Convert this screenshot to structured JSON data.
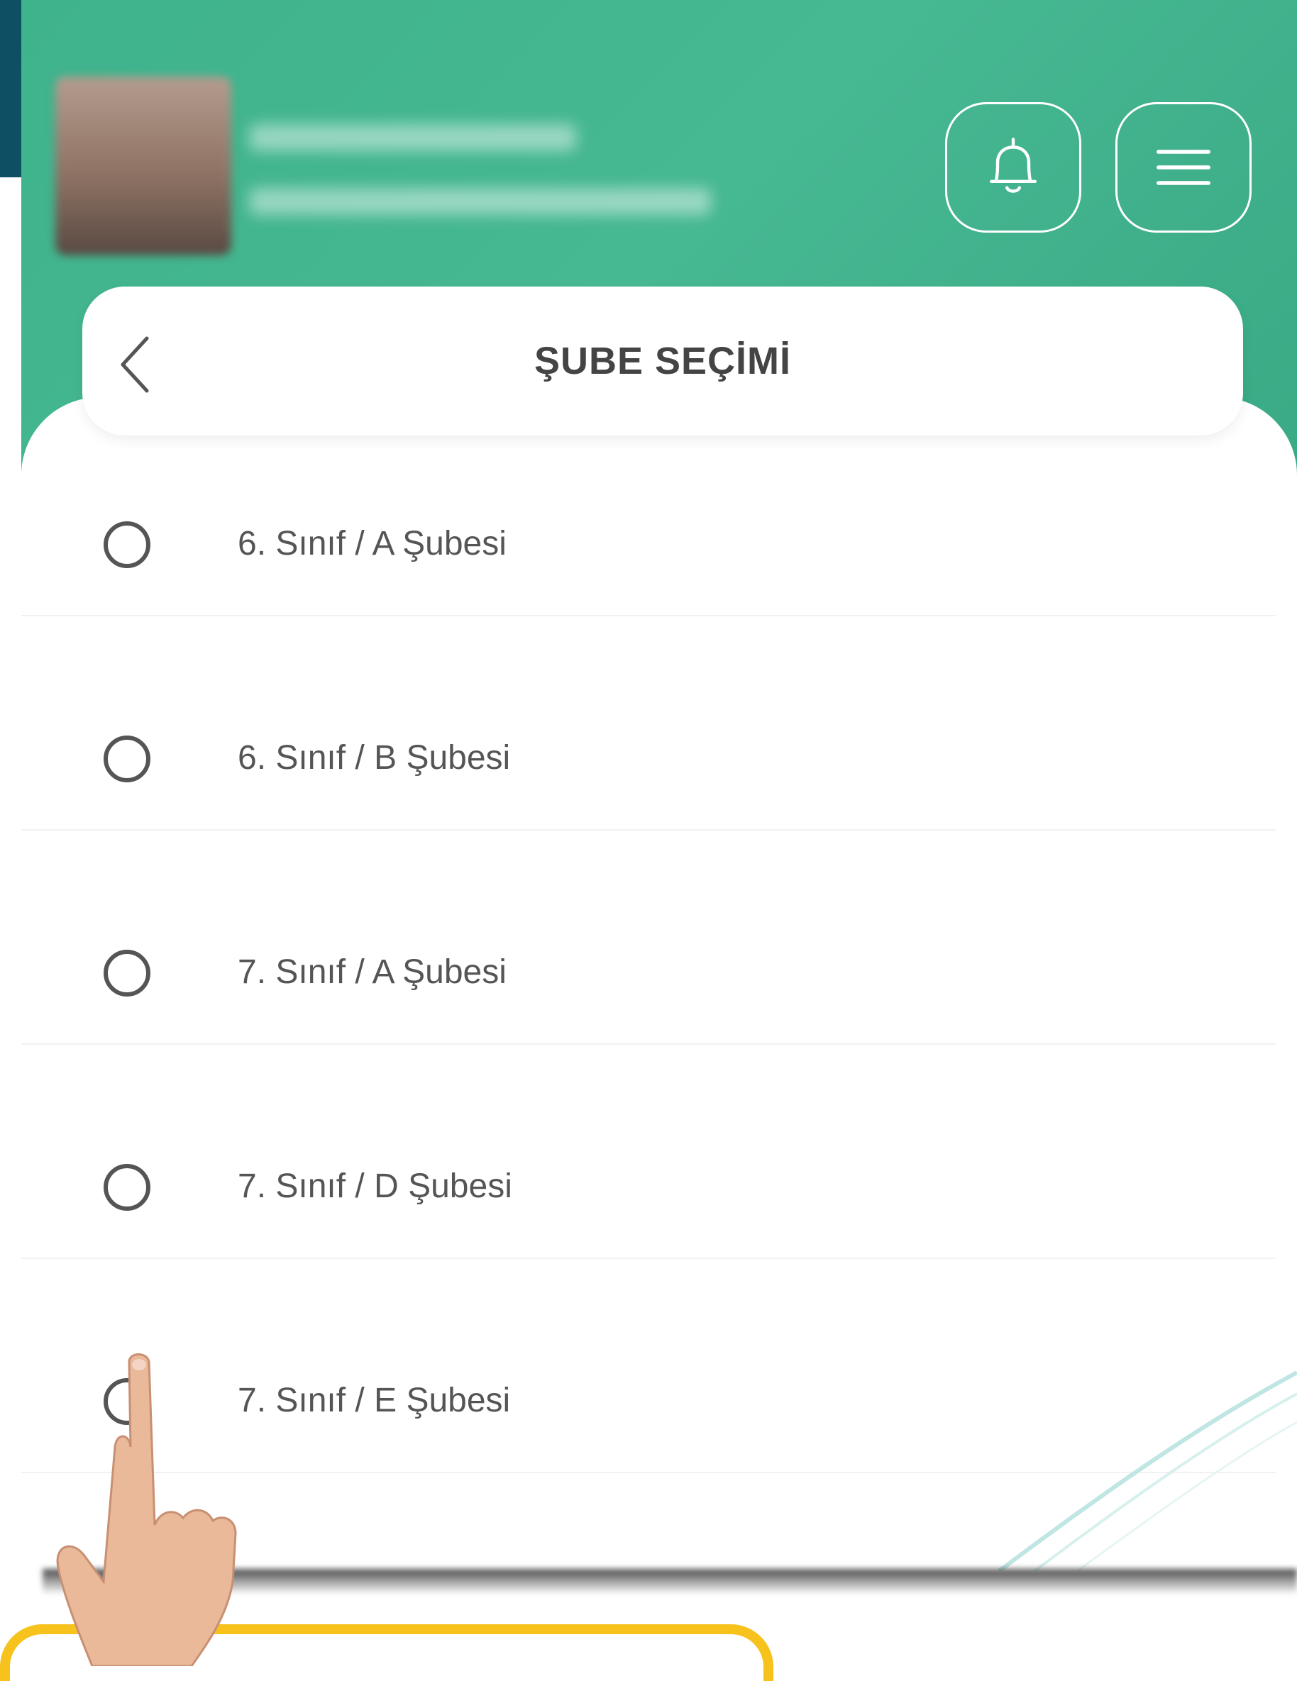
{
  "header": {
    "bell_icon": "bell-icon",
    "menu_icon": "hamburger-menu-icon"
  },
  "page": {
    "title": "ŞUBE SEÇİMİ",
    "back_icon": "chevron-left-icon"
  },
  "sections": [
    {
      "label": "6. Sınıf / A Şubesi",
      "selected": false
    },
    {
      "label": "6. Sınıf / B Şubesi",
      "selected": false
    },
    {
      "label": "7. Sınıf / A Şubesi",
      "selected": false
    },
    {
      "label": "7. Sınıf / D Şubesi",
      "selected": false
    },
    {
      "label": "7. Sınıf / E Şubesi",
      "selected": false
    }
  ],
  "colors": {
    "header_green": "#44b38e",
    "accent_yellow": "#f7c21c",
    "text_gray": "#555555"
  }
}
